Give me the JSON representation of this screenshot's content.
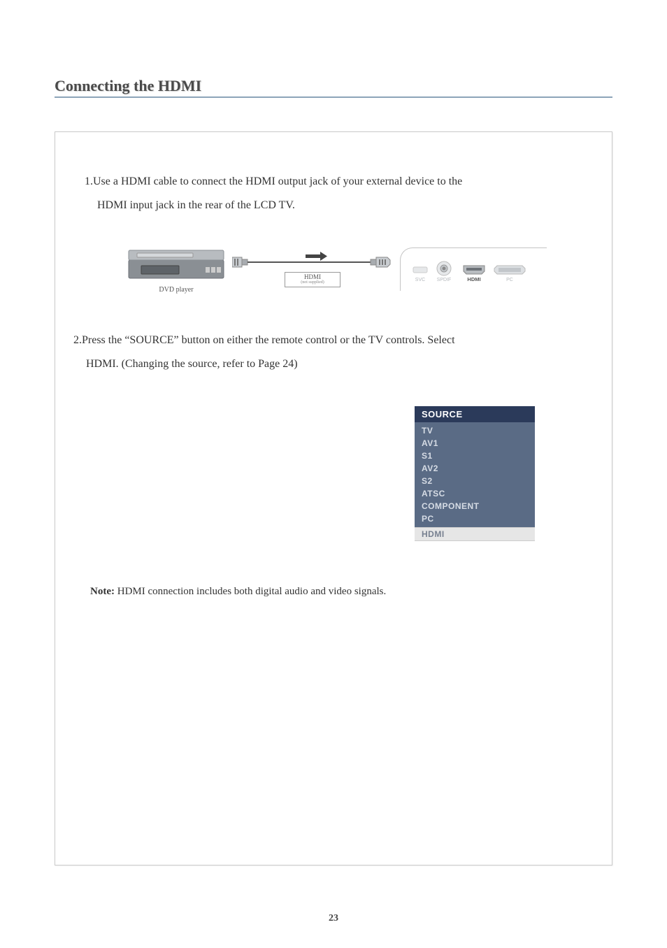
{
  "heading": "Connecting the HDMI",
  "step1_line1": "1.Use a HDMI cable to connect the HDMI output jack of your external device to the",
  "step1_line2": "HDMI input jack in the rear of the LCD TV.",
  "diagram": {
    "dvd_label": "DVD player",
    "cable_label": "HDMI",
    "cable_sub": "(not supplied)",
    "ports": [
      "SVC",
      "SPDIF",
      "HDMI",
      "PC"
    ]
  },
  "step2_line1": "2.Press the “SOURCE” button on either the remote control or the TV controls. Select",
  "step2_line2": "HDMI. (Changing the source, refer to Page 24)",
  "source_menu": {
    "header": "SOURCE",
    "items": [
      "TV",
      "AV1",
      "S1",
      "AV2",
      "S2",
      "ATSC",
      "COMPONENT",
      "PC"
    ],
    "selected": "HDMI"
  },
  "note_label": "Note:",
  "note_body": " HDMI connection includes both digital audio and video signals.",
  "page_number": "23"
}
